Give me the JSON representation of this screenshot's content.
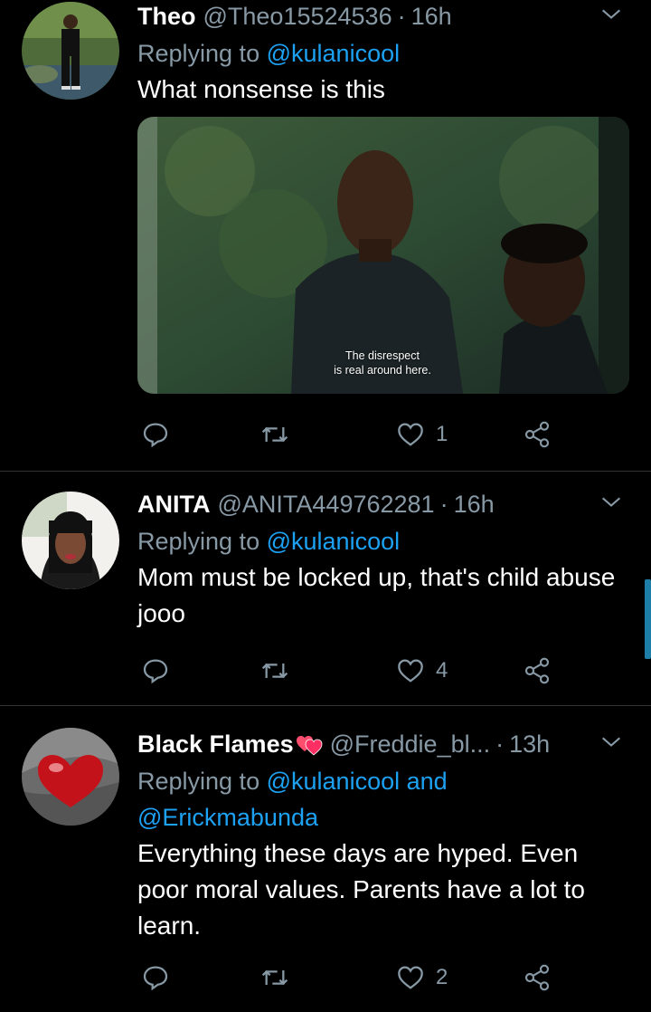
{
  "tweets": [
    {
      "name": "Theo",
      "handle": "@Theo15524536",
      "dot": "·",
      "time": "16h",
      "reply_prefix": "Replying to",
      "reply_to": "@kulanicool",
      "text": "What nonsense is this",
      "media_caption_1": "The disrespect",
      "media_caption_2": "is real around here.",
      "likes": "1",
      "avatar_icon": "avatar-photo-person-outdoors"
    },
    {
      "name": "ANITA",
      "handle": "@ANITA449762281",
      "dot": "·",
      "time": "16h",
      "reply_prefix": "Replying to",
      "reply_to": "@kulanicool",
      "text": "Mom must be locked up, that's child abuse jooo",
      "likes": "4",
      "avatar_icon": "avatar-photo-woman"
    },
    {
      "name": "Black Flames",
      "handle": "@Freddie_bl...",
      "dot": "·",
      "time": "13h",
      "reply_prefix": "Replying to",
      "reply_to": "@kulanicool and",
      "reply_to_2": "@Erickmabunda",
      "text": "Everything these days are hyped. Even poor moral values. Parents have a lot to learn.",
      "likes": "2",
      "avatar_icon": "avatar-red-heart"
    }
  ],
  "colors": {
    "background": "#000000",
    "secondary_text": "#8899a6",
    "link": "#1da1f2",
    "divider": "#2f3336"
  }
}
